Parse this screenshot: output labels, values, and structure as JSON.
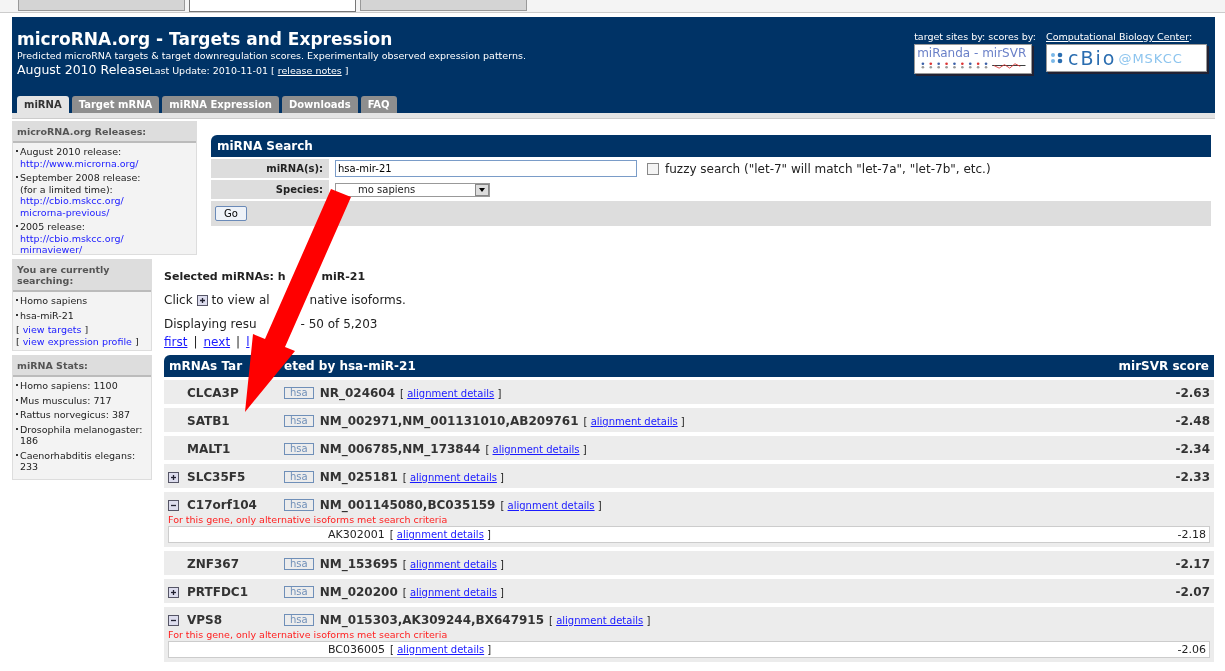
{
  "browser_tabs": [
    {
      "selected": false
    },
    {
      "selected": true
    },
    {
      "selected": false
    }
  ],
  "header": {
    "title": "microRNA.org - Targets and Expression",
    "subtitle": "Predicted microRNA targets & target downregulation scores. Experimentally observed expression patterns.",
    "release": "August 2010 Release",
    "last_update": {
      "before": "Last Update: 2010-11-01 [",
      "link": "release notes",
      "after": "]"
    },
    "credits_label": "target sites by: scores by:",
    "mirsvr_logo": {
      "left": "miRanda",
      "sep": "-",
      "right": "mirSVR"
    },
    "center_link": "Computational Biology Center",
    "center_colon": ":",
    "cbio_logo": {
      "main": "cBio",
      "suffix": "@MSKCC"
    }
  },
  "nav_tabs": [
    {
      "label": "miRNA",
      "selected": true
    },
    {
      "label": "Target mRNA",
      "selected": false
    },
    {
      "label": "miRNA Expression",
      "selected": false
    },
    {
      "label": "Downloads",
      "selected": false
    },
    {
      "label": "FAQ",
      "selected": false
    }
  ],
  "sidebar": {
    "releases": {
      "title": "microRNA.org Releases:",
      "items": [
        {
          "lines": [
            "August 2010 release:"
          ],
          "links": [
            "http://www.microrna.org/"
          ]
        },
        {
          "lines": [
            "September 2008 release:",
            "(for a limited time):"
          ],
          "links": [
            "http://cbio.mskcc.org/",
            "microrna-previous/"
          ]
        },
        {
          "lines": [
            "2005 release:"
          ],
          "links": [
            "http://cbio.mskcc.org/",
            "mirnaviewer/"
          ]
        }
      ]
    },
    "searching": {
      "title": "You are currently searching:",
      "items": [
        "Homo sapiens",
        "hsa-miR-21"
      ],
      "links": [
        {
          "before": "[",
          "link": "view targets",
          "after": "]"
        },
        {
          "before": "[",
          "link": "view expression profile",
          "after": "]"
        }
      ]
    },
    "stats": {
      "title": "miRNA Stats:",
      "items": [
        "Homo sapiens: 1100",
        "Mus musculus: 717",
        "Rattus norvegicus: 387",
        "Drosophila melanogaster: 186",
        "Caenorhabditis elegans: 233"
      ]
    }
  },
  "search": {
    "title": "miRNA Search",
    "mirna_label": "miRNA(s):",
    "mirna_value": "hsa-mir-21",
    "fuzzy": {
      "checked": false,
      "label": "fuzzy search (\"let-7\" will match \"let-7a\", \"let-7b\", etc.)"
    },
    "species_label": "Species:",
    "species_value": "mo sapiens",
    "go": "Go"
  },
  "results": {
    "selected": [
      "Selected miRNAs: h",
      "miR-21"
    ],
    "click": [
      "Click",
      "to view al",
      "native isoforms."
    ],
    "displaying": [
      "Displaying resu",
      "- 50 of 5,203"
    ],
    "pager": [
      {
        "kind": "link",
        "label": "first"
      },
      {
        "kind": "separator",
        "label": "|"
      },
      {
        "kind": "link",
        "label": "next"
      },
      {
        "kind": "separator",
        "label": "|"
      },
      {
        "kind": "link",
        "label": "l"
      }
    ],
    "table": {
      "heading": [
        "mRNAs Tar",
        "eted by hsa-miR-21"
      ],
      "score_heading": "mirSVR score",
      "rows": [
        {
          "gene": "CLCA3P",
          "species": "hsa",
          "accessions": "NR_024604",
          "link": {
            "before": "[",
            "link": "alignment details",
            "after": "]"
          },
          "score": "-2.63"
        },
        {
          "gene": "SATB1",
          "species": "hsa",
          "accessions": "NM_002971,NM_001131010,AB209761",
          "link": {
            "before": "[",
            "link": "alignment details",
            "after": "]"
          },
          "score": "-2.48"
        },
        {
          "gene": "MALT1",
          "species": "hsa",
          "accessions": "NM_006785,NM_173844",
          "link": {
            "before": "[",
            "link": "alignment details",
            "after": "]"
          },
          "score": "-2.34"
        },
        {
          "gene": "SLC35F5",
          "expandable": true,
          "expanded": false,
          "species": "hsa",
          "accessions": "NM_025181",
          "link": {
            "before": "[",
            "link": "alignment details",
            "after": "]"
          },
          "score": "-2.33"
        },
        {
          "gene": "C17orf104",
          "expandable": true,
          "expanded": true,
          "species": "hsa",
          "accessions": "NM_001145080,BC035159",
          "link": {
            "before": "[",
            "link": "alignment details",
            "after": "]"
          },
          "note": "For this gene, only alternative isoforms met search criteria",
          "isoforms": [
            {
              "accession": "AK302001",
              "link": {
                "before": "[",
                "link": "alignment details",
                "after": "]"
              },
              "score": "-2.18"
            }
          ]
        },
        {
          "gene": "ZNF367",
          "species": "hsa",
          "accessions": "NM_153695",
          "link": {
            "before": "[",
            "link": "alignment details",
            "after": "]"
          },
          "score": "-2.17"
        },
        {
          "gene": "PRTFDC1",
          "expandable": true,
          "expanded": false,
          "species": "hsa",
          "accessions": "NM_020200",
          "link": {
            "before": "[",
            "link": "alignment details",
            "after": "]"
          },
          "score": "-2.07"
        },
        {
          "gene": "VPS8",
          "expandable": true,
          "expanded": true,
          "species": "hsa",
          "accessions": "NM_015303,AK309244,BX647915",
          "link": {
            "before": "[",
            "link": "alignment details",
            "after": "]"
          },
          "note": "For this gene, only alternative isoforms met search criteria",
          "isoforms": [
            {
              "accession": "BC036005",
              "link": {
                "before": "[",
                "link": "alignment details",
                "after": "]"
              },
              "score": "-2.06"
            }
          ]
        }
      ]
    }
  }
}
